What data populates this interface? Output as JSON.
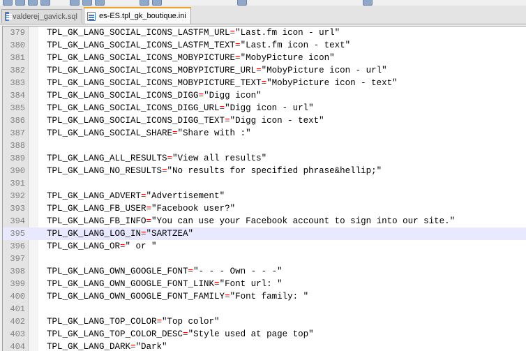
{
  "tabs": [
    {
      "label": "valderej_gavick.sql",
      "icon": "sql-file-icon",
      "active": false
    },
    {
      "label": "es-ES.tpl_gk_boutique.ini",
      "icon": "ini-file-icon",
      "active": true
    }
  ],
  "editor": {
    "current_line": 395,
    "lines": [
      {
        "num": "379",
        "key": "TPL_GK_LANG_SOCIAL_ICONS_LASTFM_URL",
        "val": "\"Last.fm icon - url\""
      },
      {
        "num": "380",
        "key": "TPL_GK_LANG_SOCIAL_ICONS_LASTFM_TEXT",
        "val": "\"Last.fm icon - text\""
      },
      {
        "num": "381",
        "key": "TPL_GK_LANG_SOCIAL_ICONS_MOBYPICTURE",
        "val": "\"MobyPicture icon\""
      },
      {
        "num": "382",
        "key": "TPL_GK_LANG_SOCIAL_ICONS_MOBYPICTURE_URL",
        "val": "\"MobyPicture icon - url\""
      },
      {
        "num": "383",
        "key": "TPL_GK_LANG_SOCIAL_ICONS_MOBYPICTURE_TEXT",
        "val": "\"MobyPicture icon - text\""
      },
      {
        "num": "384",
        "key": "TPL_GK_LANG_SOCIAL_ICONS_DIGG",
        "val": "\"Digg icon\""
      },
      {
        "num": "385",
        "key": "TPL_GK_LANG_SOCIAL_ICONS_DIGG_URL",
        "val": "\"Digg icon - url\""
      },
      {
        "num": "386",
        "key": "TPL_GK_LANG_SOCIAL_ICONS_DIGG_TEXT",
        "val": "\"Digg icon - text\""
      },
      {
        "num": "387",
        "key": "TPL_GK_LANG_SOCIAL_SHARE",
        "val": "\"Share with :\""
      },
      {
        "num": "388",
        "key": "",
        "val": ""
      },
      {
        "num": "389",
        "key": "TPL_GK_LANG_ALL_RESULTS",
        "val": "\"View all results\""
      },
      {
        "num": "390",
        "key": "TPL_GK_LANG_NO_RESULTS",
        "val": "\"No results for specified phrase&hellip;\""
      },
      {
        "num": "391",
        "key": "",
        "val": ""
      },
      {
        "num": "392",
        "key": "TPL_GK_LANG_ADVERT",
        "val": "\"Advertisement\""
      },
      {
        "num": "393",
        "key": "TPL_GK_LANG_FB_USER",
        "val": "\"Facebook user?\""
      },
      {
        "num": "394",
        "key": "TPL_GK_LANG_FB_INFO",
        "val": "\"You can use your Facebook account to sign into our site.\""
      },
      {
        "num": "395",
        "key": "TPL_GK_LANG_LOG_IN",
        "val": "\"SARTZEA\""
      },
      {
        "num": "396",
        "key": "TPL_GK_LANG_OR",
        "val": "\" or \""
      },
      {
        "num": "397",
        "key": "",
        "val": ""
      },
      {
        "num": "398",
        "key": "TPL_GK_LANG_OWN_GOOGLE_FONT",
        "val": "\"- - - Own - - -\""
      },
      {
        "num": "399",
        "key": "TPL_GK_LANG_OWN_GOOGLE_FONT_LINK",
        "val": "\"Font url: \""
      },
      {
        "num": "400",
        "key": "TPL_GK_LANG_OWN_GOOGLE_FONT_FAMILY",
        "val": "\"Font family: \""
      },
      {
        "num": "401",
        "key": "",
        "val": ""
      },
      {
        "num": "402",
        "key": "TPL_GK_LANG_TOP_COLOR",
        "val": "\"Top color\""
      },
      {
        "num": "403",
        "key": "TPL_GK_LANG_TOP_COLOR_DESC",
        "val": "\"Style used at page top\""
      },
      {
        "num": "404",
        "key": "TPL_GK_LANG_DARK",
        "val": "\"Dark\""
      }
    ]
  },
  "colors": {
    "operator": "#ff0000",
    "current_line_bg": "#e8e8ff",
    "active_tab_accent": "#f4a020"
  }
}
